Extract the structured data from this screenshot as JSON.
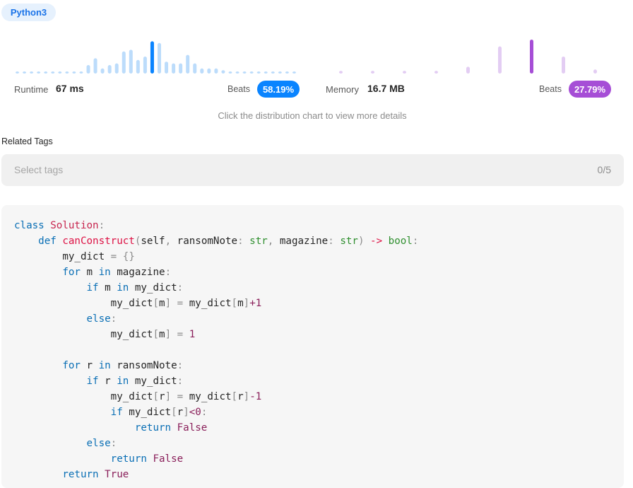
{
  "language": "Python3",
  "runtime": {
    "label": "Runtime",
    "value": "67 ms",
    "beats_label": "Beats",
    "beats_value": "58.19%",
    "color": "#0a84ff",
    "bars": [
      0.05,
      0.05,
      0.05,
      0.05,
      0.05,
      0.05,
      0.05,
      0.05,
      0.05,
      0.05,
      0.25,
      0.45,
      0.15,
      0.25,
      0.3,
      0.65,
      0.7,
      0.4,
      0.5,
      0.95,
      0.9,
      0.35,
      0.3,
      0.3,
      0.55,
      0.3,
      0.15,
      0.15,
      0.15,
      0.1,
      0.05,
      0.05,
      0.05,
      0.05,
      0.05,
      0.05,
      0.05,
      0.05,
      0.05,
      0.05
    ],
    "highlight_index": 19
  },
  "memory": {
    "label": "Memory",
    "value": "16.7 MB",
    "beats_label": "Beats",
    "beats_value": "27.79%",
    "color": "#a64ed6",
    "bars": [
      0.08,
      0.08,
      0.08,
      0.08,
      0.2,
      0.8,
      1.0,
      0.5,
      0.12
    ],
    "highlight_index": 6
  },
  "hint": "Click the distribution chart to view more details",
  "related_tags": {
    "title": "Related Tags",
    "placeholder": "Select tags",
    "count": "0/5"
  },
  "code_lines": [
    "class Solution:",
    "    def canConstruct(self, ransomNote: str, magazine: str) -> bool:",
    "        my_dict = {}",
    "        for m in magazine:",
    "            if m in my_dict:",
    "                my_dict[m] = my_dict[m]+1",
    "            else:",
    "                my_dict[m] = 1",
    "",
    "        for r in ransomNote:",
    "            if r in my_dict:",
    "                my_dict[r] = my_dict[r]-1",
    "                if my_dict[r]<0:",
    "                    return False",
    "            else:",
    "                return False",
    "        return True"
  ]
}
